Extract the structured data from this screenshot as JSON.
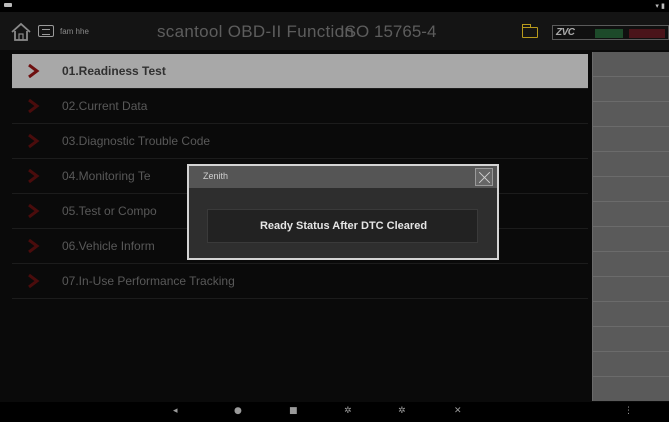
{
  "status_bar": {
    "right_icons": "▾ ▮"
  },
  "title_bar": {
    "home_icon": "home-icon",
    "obd_badge": "obd-icon",
    "subtitle": "fam hhe",
    "title": "scantool OBD-II Function",
    "standard": "ISO 15765-4",
    "folder_icon": "folder-icon",
    "brand": "ZVC"
  },
  "menu": {
    "items": [
      {
        "label": "01.Readiness Test",
        "selected": true
      },
      {
        "label": "02.Current Data",
        "selected": false
      },
      {
        "label": "03.Diagnostic Trouble Code",
        "selected": false
      },
      {
        "label": "04.Monitoring Te",
        "selected": false
      },
      {
        "label": "05.Test or Compo",
        "selected": false
      },
      {
        "label": "06.Vehicle Inform",
        "selected": false
      },
      {
        "label": "07.In-Use Performance Tracking",
        "selected": false
      }
    ]
  },
  "dialog": {
    "title": "Zenith",
    "message": "Ready Status After DTC Cleared",
    "close_icon": "close-icon"
  },
  "nav_bar": {
    "back": "◂",
    "home": "●",
    "recents": "■",
    "settings_a": "✲",
    "settings_b": "✲",
    "close": "✕",
    "menu": "⋮"
  },
  "colors": {
    "accent_chevron": "#6e1010",
    "selected_row": "#a8a8a8",
    "folder": "#b89a1c"
  }
}
